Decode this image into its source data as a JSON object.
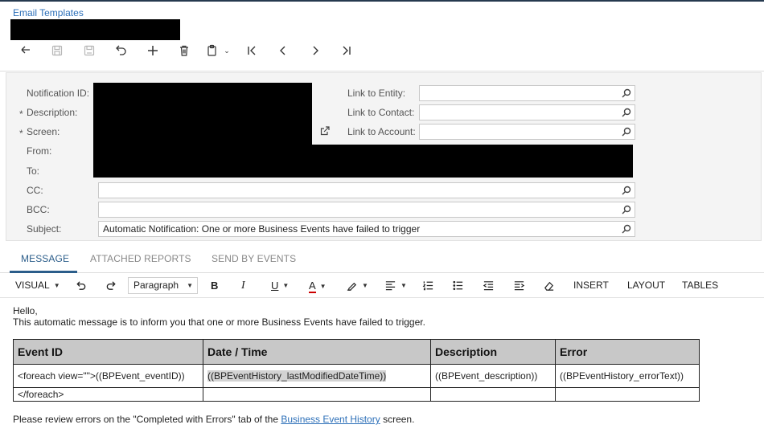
{
  "page": {
    "title": "Email Templates"
  },
  "toolbar": {
    "buttons": [
      {
        "name": "back-icon",
        "disabled": false
      },
      {
        "name": "save-close-icon",
        "disabled": true
      },
      {
        "name": "save-icon",
        "disabled": true
      },
      {
        "name": "undo-icon",
        "disabled": false
      },
      {
        "name": "add-icon",
        "disabled": false
      },
      {
        "name": "delete-icon",
        "disabled": false
      },
      {
        "name": "copy-paste-icon",
        "disabled": false
      },
      {
        "name": "first-record-icon",
        "disabled": false
      },
      {
        "name": "previous-record-icon",
        "disabled": false
      },
      {
        "name": "next-record-icon",
        "disabled": false
      },
      {
        "name": "last-record-icon",
        "disabled": false
      }
    ]
  },
  "form": {
    "notification_id_label": "Notification ID:",
    "description_label": "Description:",
    "screen_label": "Screen:",
    "from_label": "From:",
    "to_label": "To:",
    "cc_label": "CC:",
    "bcc_label": "BCC:",
    "subject_label": "Subject:",
    "required_marker": "*",
    "link_entity_label": "Link to Entity:",
    "link_contact_label": "Link to Contact:",
    "link_account_label": "Link to Account:",
    "cc_value": "",
    "bcc_value": "",
    "subject_value": "Automatic Notification: One or more Business Events have failed to trigger",
    "link_entity_value": "",
    "link_contact_value": "",
    "link_account_value": ""
  },
  "tabs": [
    {
      "label": "MESSAGE",
      "active": true
    },
    {
      "label": "ATTACHED REPORTS",
      "active": false
    },
    {
      "label": "SEND BY EVENTS",
      "active": false
    }
  ],
  "editor_toolbar": {
    "mode": "VISUAL",
    "paragraph": "Paragraph",
    "insert": "INSERT",
    "layout": "LAYOUT",
    "tables": "TABLES"
  },
  "message": {
    "greeting": "Hello,",
    "intro": "This automatic message is to inform you that one or more Business Events have failed to trigger.",
    "table": {
      "headers": [
        "Event ID",
        "Date / Time",
        "Description",
        "Error"
      ],
      "row1": [
        "<foreach view=\"\">((BPEvent_eventID))",
        "((BPEventHistory_lastModifiedDateTime))",
        "((BPEvent_description))",
        "((BPEventHistory_errorText))"
      ],
      "row2": [
        "</foreach>",
        "",
        "",
        ""
      ]
    },
    "footer_before": "Please review errors on the \"Completed with Errors\" tab of the ",
    "footer_link": "Business Event History",
    "footer_after": " screen."
  }
}
